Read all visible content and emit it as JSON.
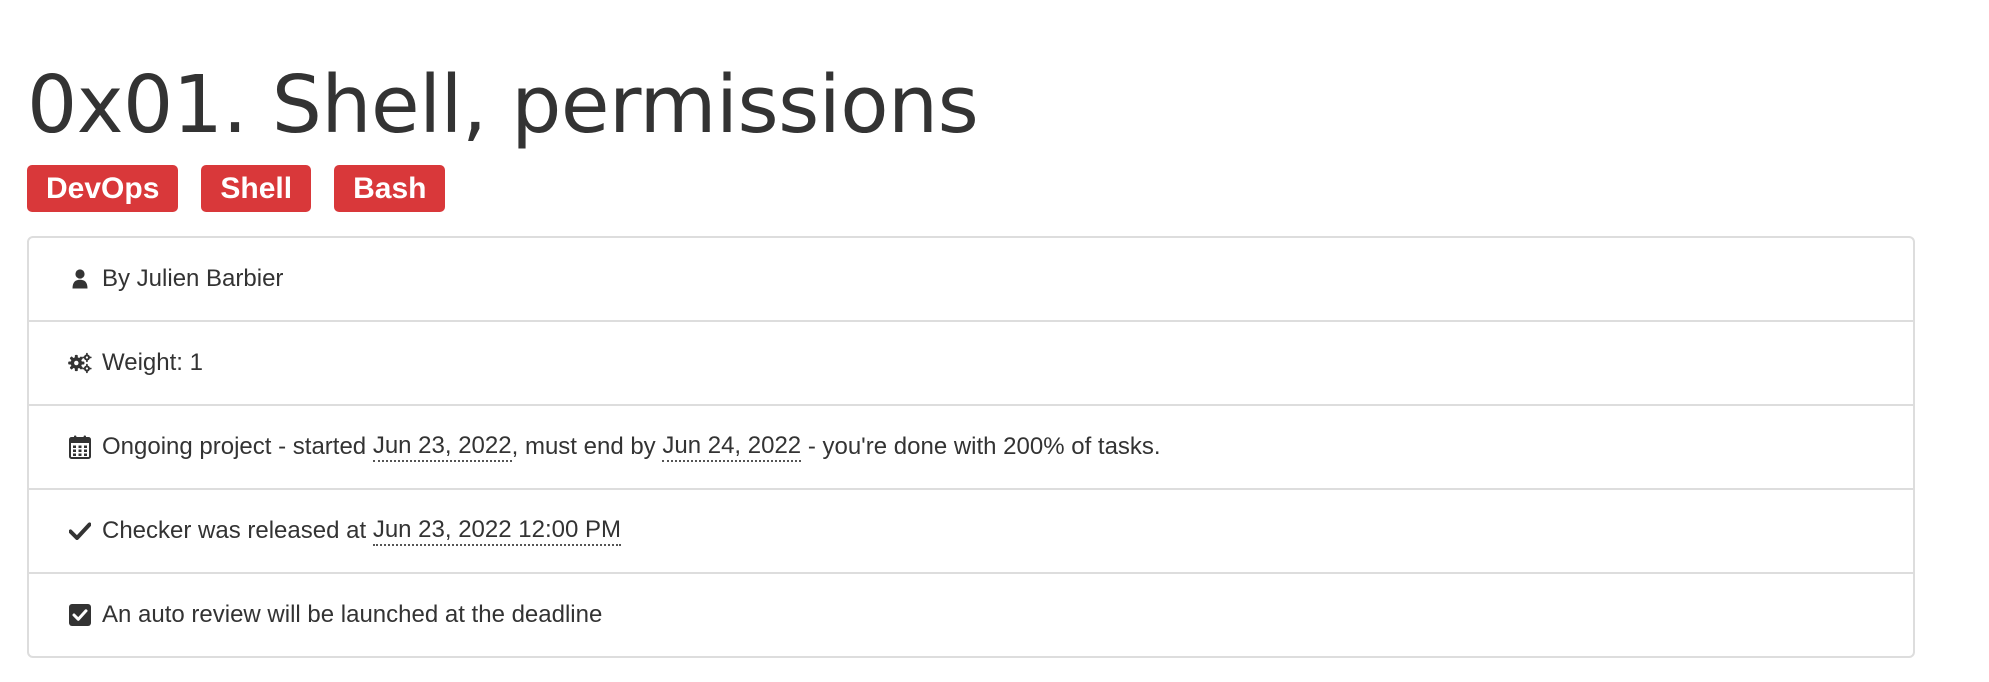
{
  "title": "0x01. Shell, permissions",
  "tags": [
    "DevOps",
    "Shell",
    "Bash"
  ],
  "info": {
    "author": "By Julien Barbier",
    "weight": "Weight: 1",
    "progress": {
      "prefix": "Ongoing project - started",
      "start_date": "Jun 23, 2022",
      "middle": ", must end by",
      "end_date": "Jun 24, 2022",
      "suffix": "- you're done with 200% of tasks."
    },
    "checker": {
      "prefix": "Checker was released at",
      "datetime": "Jun 23, 2022 12:00 PM"
    },
    "auto_review": "An auto review will be launched at the deadline"
  },
  "icons": {
    "author": "user-icon",
    "weight": "gears-icon",
    "progress": "calendar-icon",
    "checker": "check-icon",
    "auto_review": "check-square-icon"
  },
  "colors": {
    "tag_background": "#d9383a",
    "tag_text": "#ffffff",
    "text": "#333333",
    "border": "#dddddd"
  }
}
